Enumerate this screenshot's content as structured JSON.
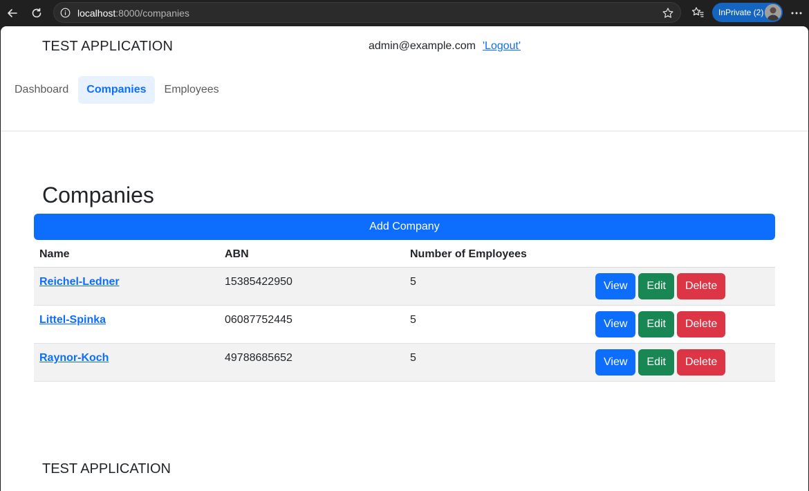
{
  "browser": {
    "url_host": "localhost",
    "url_path": ":8000/companies",
    "inprivate_label": "InPrivate (2)"
  },
  "header": {
    "brand": "TEST APPLICATION",
    "user_email": "admin@example.com",
    "logout_label": "'Logout'"
  },
  "nav": {
    "items": [
      {
        "label": "Dashboard"
      },
      {
        "label": "Companies"
      },
      {
        "label": "Employees"
      }
    ]
  },
  "main": {
    "heading": "Companies",
    "add_button_label": "Add Company",
    "table": {
      "headers": [
        "Name",
        "ABN",
        "Number of Employees"
      ],
      "rows": [
        {
          "name": "Reichel-Ledner",
          "abn": "15385422950",
          "employees": "5"
        },
        {
          "name": "Littel-Spinka",
          "abn": "06087752445",
          "employees": "5"
        },
        {
          "name": "Raynor-Koch",
          "abn": "49788685652",
          "employees": "5"
        }
      ],
      "actions": {
        "view": "View",
        "edit": "Edit",
        "delete": "Delete"
      }
    }
  },
  "footer": {
    "brand": "TEST APPLICATION"
  },
  "colors": {
    "primary": "#0d6efd",
    "success": "#198754",
    "danger": "#dc3545",
    "browser_chrome": "#202020"
  }
}
